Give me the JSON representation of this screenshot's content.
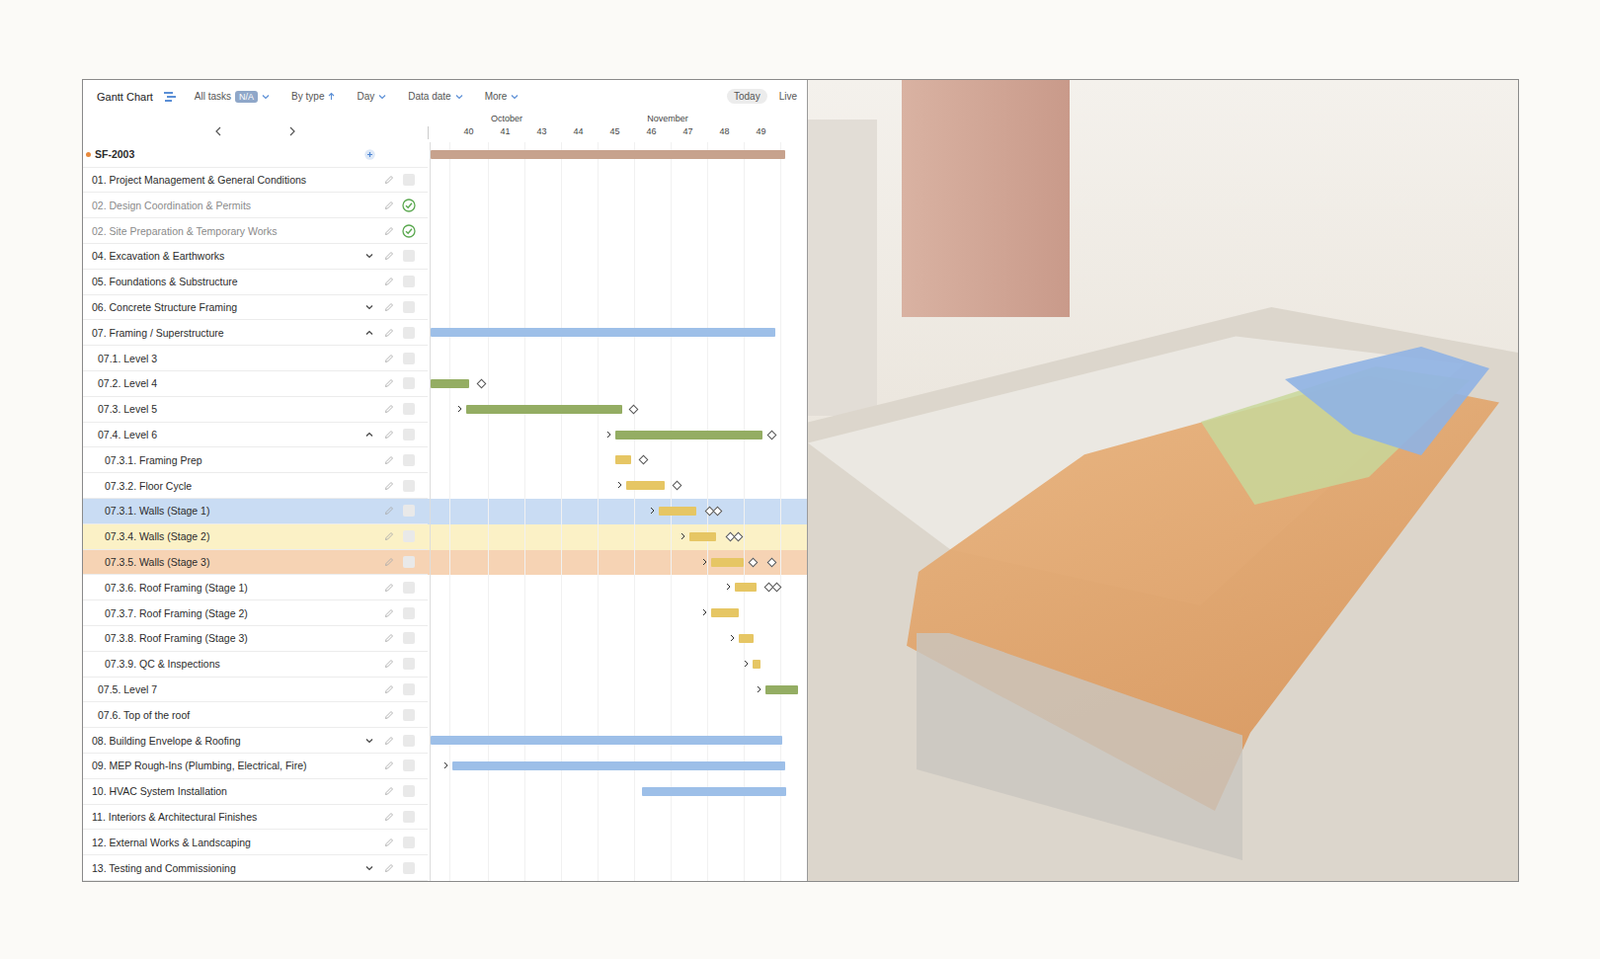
{
  "toolbar": {
    "title": "Gantt Chart",
    "filter": "All tasks",
    "filter_badge": "N/A",
    "group": "By type",
    "scale": "Day",
    "data_date": "Data date",
    "more": "More",
    "today": "Today",
    "live": "Live"
  },
  "timeline": {
    "months": [
      "October",
      "November"
    ],
    "weeks": [
      "40",
      "41",
      "43",
      "44",
      "45",
      "46",
      "47",
      "48",
      "49"
    ]
  },
  "project": {
    "name": "SF-2003",
    "bar": {
      "start": 0,
      "end": 0.964,
      "color": "#c7a28d"
    }
  },
  "rows": [
    {
      "name": "01. Project Management & General Conditions",
      "indent": 0,
      "expandable": false,
      "expanded": false,
      "done": false,
      "highlight": null,
      "bar": null,
      "dependency": false,
      "milestones": []
    },
    {
      "name": "02. Design Coordination & Permits",
      "indent": 0,
      "expandable": false,
      "expanded": false,
      "done": true,
      "highlight": null,
      "bar": null,
      "dependency": false,
      "milestones": []
    },
    {
      "name": "02. Site Preparation & Temporary Works",
      "indent": 0,
      "expandable": false,
      "expanded": false,
      "done": true,
      "highlight": null,
      "bar": null,
      "dependency": false,
      "milestones": []
    },
    {
      "name": "04. Excavation & Earthworks",
      "indent": 0,
      "expandable": true,
      "expanded": false,
      "done": false,
      "highlight": null,
      "bar": null,
      "dependency": false,
      "milestones": []
    },
    {
      "name": "05. Foundations & Substructure",
      "indent": 0,
      "expandable": false,
      "expanded": false,
      "done": false,
      "highlight": null,
      "bar": null,
      "dependency": false,
      "milestones": []
    },
    {
      "name": "06. Concrete Structure Framing",
      "indent": 0,
      "expandable": true,
      "expanded": false,
      "done": false,
      "highlight": null,
      "bar": null,
      "dependency": false,
      "milestones": []
    },
    {
      "name": "07. Framing / Superstructure",
      "indent": 0,
      "expandable": true,
      "expanded": true,
      "done": false,
      "highlight": null,
      "bar": {
        "start": 0,
        "end": 0.939,
        "color": "#9dbfe8"
      },
      "dependency": false,
      "milestones": []
    },
    {
      "name": "07.1. Level 3",
      "indent": 1,
      "expandable": false,
      "expanded": false,
      "done": false,
      "highlight": null,
      "bar": null,
      "dependency": false,
      "milestones": []
    },
    {
      "name": "07.2. Level 4",
      "indent": 1,
      "expandable": false,
      "expanded": false,
      "done": false,
      "highlight": null,
      "bar": {
        "start": 0,
        "end": 0.106,
        "color": "#94ad63"
      },
      "dependency": false,
      "milestones": [
        {
          "pos": 0.136,
          "double": false
        }
      ]
    },
    {
      "name": "07.3. Level 5",
      "indent": 1,
      "expandable": false,
      "expanded": false,
      "done": false,
      "highlight": null,
      "bar": {
        "start": 0.097,
        "end": 0.522,
        "color": "#94ad63"
      },
      "dependency": true,
      "milestones": [
        {
          "pos": 0.55,
          "double": false
        }
      ]
    },
    {
      "name": "07.4. Level 6",
      "indent": 1,
      "expandable": true,
      "expanded": true,
      "done": false,
      "highlight": null,
      "bar": {
        "start": 0.503,
        "end": 0.903,
        "color": "#94ad63"
      },
      "dependency": true,
      "milestones": [
        {
          "pos": 0.928,
          "double": false
        }
      ]
    },
    {
      "name": "07.3.1. Framing Prep",
      "indent": 2,
      "expandable": false,
      "expanded": false,
      "done": false,
      "highlight": null,
      "bar": {
        "start": 0.503,
        "end": 0.547,
        "color": "#e6c664"
      },
      "dependency": false,
      "milestones": [
        {
          "pos": 0.578,
          "double": false
        }
      ]
    },
    {
      "name": "07.3.2. Floor Cycle",
      "indent": 2,
      "expandable": false,
      "expanded": false,
      "done": false,
      "highlight": null,
      "bar": {
        "start": 0.531,
        "end": 0.636,
        "color": "#e6c664"
      },
      "dependency": true,
      "milestones": [
        {
          "pos": 0.669,
          "double": false
        }
      ]
    },
    {
      "name": "07.3.1. Walls (Stage 1)",
      "indent": 2,
      "expandable": false,
      "expanded": false,
      "done": false,
      "highlight": "#c9dcf3",
      "bar": {
        "start": 0.622,
        "end": 0.722,
        "color": "#e6c664"
      },
      "dependency": true,
      "milestones": [
        {
          "pos": 0.758,
          "double": true
        }
      ]
    },
    {
      "name": "07.3.4. Walls (Stage 2)",
      "indent": 2,
      "expandable": false,
      "expanded": false,
      "done": false,
      "highlight": "#fbf1c6",
      "bar": {
        "start": 0.703,
        "end": 0.778,
        "color": "#e6c664"
      },
      "dependency": true,
      "milestones": [
        {
          "pos": 0.814,
          "double": true
        }
      ]
    },
    {
      "name": "07.3.5. Walls (Stage 3)",
      "indent": 2,
      "expandable": false,
      "expanded": false,
      "done": false,
      "highlight": "#f6d3b4",
      "bar": {
        "start": 0.764,
        "end": 0.853,
        "color": "#e6c664"
      },
      "dependency": true,
      "milestones": [
        {
          "pos": 0.875,
          "double": false
        },
        {
          "pos": 0.928,
          "double": false
        }
      ]
    },
    {
      "name": "07.3.6. Roof Framing (Stage 1)",
      "indent": 2,
      "expandable": false,
      "expanded": false,
      "done": false,
      "highlight": null,
      "bar": {
        "start": 0.828,
        "end": 0.886,
        "color": "#e6c664"
      },
      "dependency": true,
      "milestones": [
        {
          "pos": 0.919,
          "double": true
        }
      ]
    },
    {
      "name": "07.3.7. Roof Framing (Stage 2)",
      "indent": 2,
      "expandable": false,
      "expanded": false,
      "done": false,
      "highlight": null,
      "bar": {
        "start": 0.764,
        "end": 0.839,
        "color": "#e6c664"
      },
      "dependency": true,
      "milestones": []
    },
    {
      "name": "07.3.8. Roof Framing (Stage 3)",
      "indent": 2,
      "expandable": false,
      "expanded": false,
      "done": false,
      "highlight": null,
      "bar": {
        "start": 0.839,
        "end": 0.878,
        "color": "#e6c664"
      },
      "dependency": true,
      "milestones": []
    },
    {
      "name": "07.3.9. QC & Inspections",
      "indent": 2,
      "expandable": false,
      "expanded": false,
      "done": false,
      "highlight": null,
      "bar": {
        "start": 0.875,
        "end": 0.897,
        "color": "#e6c664"
      },
      "dependency": true,
      "milestones": []
    },
    {
      "name": "07.5. Level 7",
      "indent": 1,
      "expandable": false,
      "expanded": false,
      "done": false,
      "highlight": null,
      "bar": {
        "start": 0.911,
        "end": 1.0,
        "color": "#94ad63"
      },
      "dependency": true,
      "milestones": []
    },
    {
      "name": "07.6. Top of the roof",
      "indent": 1,
      "expandable": false,
      "expanded": false,
      "done": false,
      "highlight": null,
      "bar": null,
      "dependency": false,
      "milestones": []
    },
    {
      "name": "08. Building Envelope & Roofing",
      "indent": 0,
      "expandable": true,
      "expanded": false,
      "done": false,
      "highlight": null,
      "bar": {
        "start": 0,
        "end": 0.956,
        "color": "#9dbfe8"
      },
      "dependency": false,
      "milestones": []
    },
    {
      "name": "09. MEP Rough-Ins (Plumbing, Electrical, Fire)",
      "indent": 0,
      "expandable": false,
      "expanded": false,
      "done": false,
      "highlight": null,
      "bar": {
        "start": 0.058,
        "end": 0.964,
        "color": "#9dbfe8"
      },
      "dependency": true,
      "milestones": []
    },
    {
      "name": "10. HVAC System Installation",
      "indent": 0,
      "expandable": false,
      "expanded": false,
      "done": false,
      "highlight": null,
      "bar": {
        "start": 0.575,
        "end": 0.967,
        "color": "#9dbfe8"
      },
      "dependency": false,
      "milestones": []
    },
    {
      "name": "11. Interiors & Architectural Finishes",
      "indent": 0,
      "expandable": false,
      "expanded": false,
      "done": false,
      "highlight": null,
      "bar": null,
      "dependency": false,
      "milestones": []
    },
    {
      "name": "12. External Works & Landscaping",
      "indent": 0,
      "expandable": false,
      "expanded": false,
      "done": false,
      "highlight": null,
      "bar": null,
      "dependency": false,
      "milestones": []
    },
    {
      "name": "13. Testing and Commissioning",
      "indent": 0,
      "expandable": true,
      "expanded": false,
      "done": false,
      "highlight": null,
      "bar": null,
      "dependency": false,
      "milestones": []
    }
  ]
}
